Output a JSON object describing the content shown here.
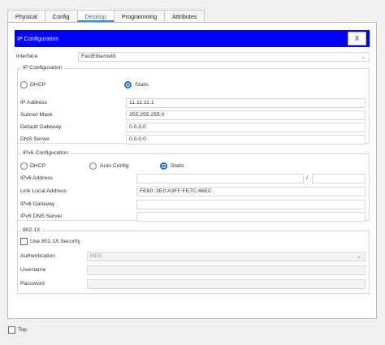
{
  "tabs": [
    {
      "label": "Physical"
    },
    {
      "label": "Config"
    },
    {
      "label": "Desktop"
    },
    {
      "label": "Programming"
    },
    {
      "label": "Attributes"
    }
  ],
  "window": {
    "title": "IP Configuration",
    "close_label": "X"
  },
  "interface": {
    "label": "Interface",
    "value": "FastEthernet0"
  },
  "ipv4": {
    "group_title": "IP Configuration",
    "dhcp_label": "DHCP",
    "static_label": "Static",
    "mode": "static",
    "ip_label": "IP Address",
    "ip_value": "11.11.11.1",
    "mask_label": "Subnet Mask",
    "mask_value": "255.255.255.0",
    "gateway_label": "Default Gateway",
    "gateway_value": "0.0.0.0",
    "dns_label": "DNS Server",
    "dns_value": "0.0.0.0"
  },
  "ipv6": {
    "group_title": "IPv6 Configuration",
    "dhcp_label": "DHCP",
    "auto_label": "Auto Config",
    "static_label": "Static",
    "mode": "static",
    "addr_label": "IPv6 Address",
    "addr_value": "",
    "prefix_sep": "/",
    "prefix_value": "",
    "link_local_label": "Link Local Address",
    "link_local_value": "FE80::2E0:A3FF:FE7C:46EC",
    "gateway_label": "IPv6 Gateway",
    "gateway_value": "",
    "dns_label": "IPv6 DNS Server",
    "dns_value": ""
  },
  "dot1x": {
    "group_title": "802.1X",
    "use_label": "Use 802.1X Security",
    "use_checked": false,
    "auth_label": "Authentication",
    "auth_value": "MD5",
    "username_label": "Username",
    "username_value": "",
    "password_label": "Password",
    "password_value": ""
  },
  "footer": {
    "top_label": "Top",
    "top_checked": false
  }
}
